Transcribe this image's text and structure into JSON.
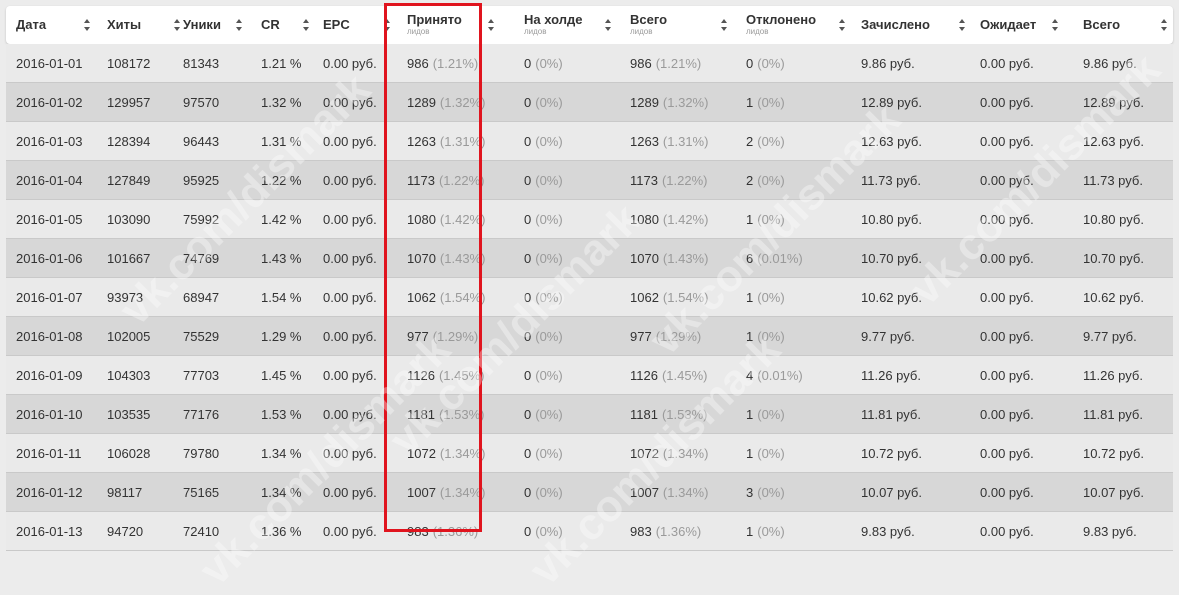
{
  "columns": [
    {
      "label": "Дата",
      "sub": "",
      "key": "date"
    },
    {
      "label": "Хиты",
      "sub": "",
      "key": "hits"
    },
    {
      "label": "Уники",
      "sub": "",
      "key": "uniques"
    },
    {
      "label": "CR",
      "sub": "",
      "key": "cr"
    },
    {
      "label": "EPC",
      "sub": "",
      "key": "epc"
    },
    {
      "label": "Принято",
      "sub": "лидов",
      "key": "accepted"
    },
    {
      "label": "На холде",
      "sub": "лидов",
      "key": "hold"
    },
    {
      "label": "Всего",
      "sub": "лидов",
      "key": "total_leads"
    },
    {
      "label": "Отклонено",
      "sub": "лидов",
      "key": "rejected"
    },
    {
      "label": "Зачислено",
      "sub": "",
      "key": "credited"
    },
    {
      "label": "Ожидает",
      "sub": "",
      "key": "pending"
    },
    {
      "label": "Всего",
      "sub": "",
      "key": "total_money"
    }
  ],
  "rows": [
    {
      "date": "2016-01-01",
      "hits": "108172",
      "uniques": "81343",
      "cr": "1.21 %",
      "epc": "0.00 руб.",
      "accepted": "986",
      "accepted_pct": "(1.21%)",
      "hold": "0",
      "hold_pct": "(0%)",
      "total_leads": "986",
      "total_leads_pct": "(1.21%)",
      "rejected": "0",
      "rejected_pct": "(0%)",
      "credited": "9.86 руб.",
      "pending": "0.00 руб.",
      "total_money": "9.86 руб."
    },
    {
      "date": "2016-01-02",
      "hits": "129957",
      "uniques": "97570",
      "cr": "1.32 %",
      "epc": "0.00 руб.",
      "accepted": "1289",
      "accepted_pct": "(1.32%)",
      "hold": "0",
      "hold_pct": "(0%)",
      "total_leads": "1289",
      "total_leads_pct": "(1.32%)",
      "rejected": "1",
      "rejected_pct": "(0%)",
      "credited": "12.89 руб.",
      "pending": "0.00 руб.",
      "total_money": "12.89 руб."
    },
    {
      "date": "2016-01-03",
      "hits": "128394",
      "uniques": "96443",
      "cr": "1.31 %",
      "epc": "0.00 руб.",
      "accepted": "1263",
      "accepted_pct": "(1.31%)",
      "hold": "0",
      "hold_pct": "(0%)",
      "total_leads": "1263",
      "total_leads_pct": "(1.31%)",
      "rejected": "2",
      "rejected_pct": "(0%)",
      "credited": "12.63 руб.",
      "pending": "0.00 руб.",
      "total_money": "12.63 руб."
    },
    {
      "date": "2016-01-04",
      "hits": "127849",
      "uniques": "95925",
      "cr": "1.22 %",
      "epc": "0.00 руб.",
      "accepted": "1173",
      "accepted_pct": "(1.22%)",
      "hold": "0",
      "hold_pct": "(0%)",
      "total_leads": "1173",
      "total_leads_pct": "(1.22%)",
      "rejected": "2",
      "rejected_pct": "(0%)",
      "credited": "11.73 руб.",
      "pending": "0.00 руб.",
      "total_money": "11.73 руб."
    },
    {
      "date": "2016-01-05",
      "hits": "103090",
      "uniques": "75992",
      "cr": "1.42 %",
      "epc": "0.00 руб.",
      "accepted": "1080",
      "accepted_pct": "(1.42%)",
      "hold": "0",
      "hold_pct": "(0%)",
      "total_leads": "1080",
      "total_leads_pct": "(1.42%)",
      "rejected": "1",
      "rejected_pct": "(0%)",
      "credited": "10.80 руб.",
      "pending": "0.00 руб.",
      "total_money": "10.80 руб."
    },
    {
      "date": "2016-01-06",
      "hits": "101667",
      "uniques": "74769",
      "cr": "1.43 %",
      "epc": "0.00 руб.",
      "accepted": "1070",
      "accepted_pct": "(1.43%)",
      "hold": "0",
      "hold_pct": "(0%)",
      "total_leads": "1070",
      "total_leads_pct": "(1.43%)",
      "rejected": "6",
      "rejected_pct": "(0.01%)",
      "credited": "10.70 руб.",
      "pending": "0.00 руб.",
      "total_money": "10.70 руб."
    },
    {
      "date": "2016-01-07",
      "hits": "93973",
      "uniques": "68947",
      "cr": "1.54 %",
      "epc": "0.00 руб.",
      "accepted": "1062",
      "accepted_pct": "(1.54%)",
      "hold": "0",
      "hold_pct": "(0%)",
      "total_leads": "1062",
      "total_leads_pct": "(1.54%)",
      "rejected": "1",
      "rejected_pct": "(0%)",
      "credited": "10.62 руб.",
      "pending": "0.00 руб.",
      "total_money": "10.62 руб."
    },
    {
      "date": "2016-01-08",
      "hits": "102005",
      "uniques": "75529",
      "cr": "1.29 %",
      "epc": "0.00 руб.",
      "accepted": "977",
      "accepted_pct": "(1.29%)",
      "hold": "0",
      "hold_pct": "(0%)",
      "total_leads": "977",
      "total_leads_pct": "(1.29%)",
      "rejected": "1",
      "rejected_pct": "(0%)",
      "credited": "9.77 руб.",
      "pending": "0.00 руб.",
      "total_money": "9.77 руб."
    },
    {
      "date": "2016-01-09",
      "hits": "104303",
      "uniques": "77703",
      "cr": "1.45 %",
      "epc": "0.00 руб.",
      "accepted": "1126",
      "accepted_pct": "(1.45%)",
      "hold": "0",
      "hold_pct": "(0%)",
      "total_leads": "1126",
      "total_leads_pct": "(1.45%)",
      "rejected": "4",
      "rejected_pct": "(0.01%)",
      "credited": "11.26 руб.",
      "pending": "0.00 руб.",
      "total_money": "11.26 руб."
    },
    {
      "date": "2016-01-10",
      "hits": "103535",
      "uniques": "77176",
      "cr": "1.53 %",
      "epc": "0.00 руб.",
      "accepted": "1181",
      "accepted_pct": "(1.53%)",
      "hold": "0",
      "hold_pct": "(0%)",
      "total_leads": "1181",
      "total_leads_pct": "(1.53%)",
      "rejected": "1",
      "rejected_pct": "(0%)",
      "credited": "11.81 руб.",
      "pending": "0.00 руб.",
      "total_money": "11.81 руб."
    },
    {
      "date": "2016-01-11",
      "hits": "106028",
      "uniques": "79780",
      "cr": "1.34 %",
      "epc": "0.00 руб.",
      "accepted": "1072",
      "accepted_pct": "(1.34%)",
      "hold": "0",
      "hold_pct": "(0%)",
      "total_leads": "1072",
      "total_leads_pct": "(1.34%)",
      "rejected": "1",
      "rejected_pct": "(0%)",
      "credited": "10.72 руб.",
      "pending": "0.00 руб.",
      "total_money": "10.72 руб."
    },
    {
      "date": "2016-01-12",
      "hits": "98117",
      "uniques": "75165",
      "cr": "1.34 %",
      "epc": "0.00 руб.",
      "accepted": "1007",
      "accepted_pct": "(1.34%)",
      "hold": "0",
      "hold_pct": "(0%)",
      "total_leads": "1007",
      "total_leads_pct": "(1.34%)",
      "rejected": "3",
      "rejected_pct": "(0%)",
      "credited": "10.07 руб.",
      "pending": "0.00 руб.",
      "total_money": "10.07 руб."
    },
    {
      "date": "2016-01-13",
      "hits": "94720",
      "uniques": "72410",
      "cr": "1.36 %",
      "epc": "0.00 руб.",
      "accepted": "983",
      "accepted_pct": "(1.36%)",
      "hold": "0",
      "hold_pct": "(0%)",
      "total_leads": "983",
      "total_leads_pct": "(1.36%)",
      "rejected": "1",
      "rejected_pct": "(0%)",
      "credited": "9.83 руб.",
      "pending": "0.00 руб.",
      "total_money": "9.83 руб."
    }
  ],
  "highlight_color": "#e0141e",
  "watermark": "vk.com/dismark"
}
